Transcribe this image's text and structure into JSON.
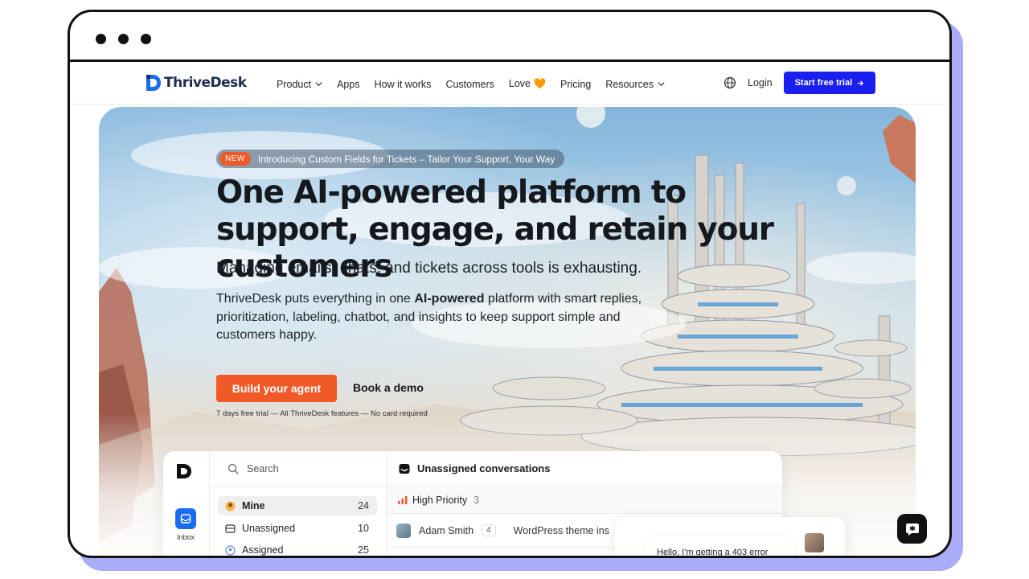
{
  "brand": {
    "name": "ThriveDesk",
    "accent": "#1a1ff0",
    "orange": "#f05a28"
  },
  "nav": {
    "items": [
      {
        "label": "Product",
        "dropdown": true
      },
      {
        "label": "Apps",
        "dropdown": false
      },
      {
        "label": "How it works",
        "dropdown": false
      },
      {
        "label": "Customers",
        "dropdown": false
      },
      {
        "label": "Love 🧡",
        "dropdown": false
      },
      {
        "label": "Pricing",
        "dropdown": false
      },
      {
        "label": "Resources",
        "dropdown": true
      }
    ],
    "login": "Login",
    "cta": "Start free trial"
  },
  "hero": {
    "badge_tag": "NEW",
    "badge_text": "Introducing Custom Fields for Tickets – Tailor Your Support, Your Way",
    "headline": "One AI-powered platform to support, engage, and retain your customers",
    "subhead": "Managing emails, chats, and tickets across tools is exhausting.",
    "body_pre": "ThriveDesk puts everything in one ",
    "body_bold": "AI-powered",
    "body_post": " platform with smart replies, prioritization, labeling, chatbot, and insights to keep support simple and customers happy.",
    "primary_button": "Build your agent",
    "secondary_button": "Book a demo",
    "trial_note": "7 days free trial — All ThriveDesk features — No card required"
  },
  "app": {
    "rail_inbox_label": "Inbox",
    "search_placeholder": "Search",
    "folders": [
      {
        "label": "Mine",
        "count": "24",
        "icon": "mine-emoji-icon",
        "active": true
      },
      {
        "label": "Unassigned",
        "count": "10",
        "icon": "inbox-tray-icon",
        "active": false
      },
      {
        "label": "Assigned",
        "count": "25",
        "icon": "assigned-icon",
        "active": false
      }
    ],
    "main_title": "Unassigned conversations",
    "priority_label": "High Priority",
    "priority_count": "3",
    "conversation": {
      "name": "Adam Smith",
      "count": "4",
      "subject": "WordPress theme ins"
    },
    "chat_preview": "Hello, I'm getting a 403 error"
  }
}
